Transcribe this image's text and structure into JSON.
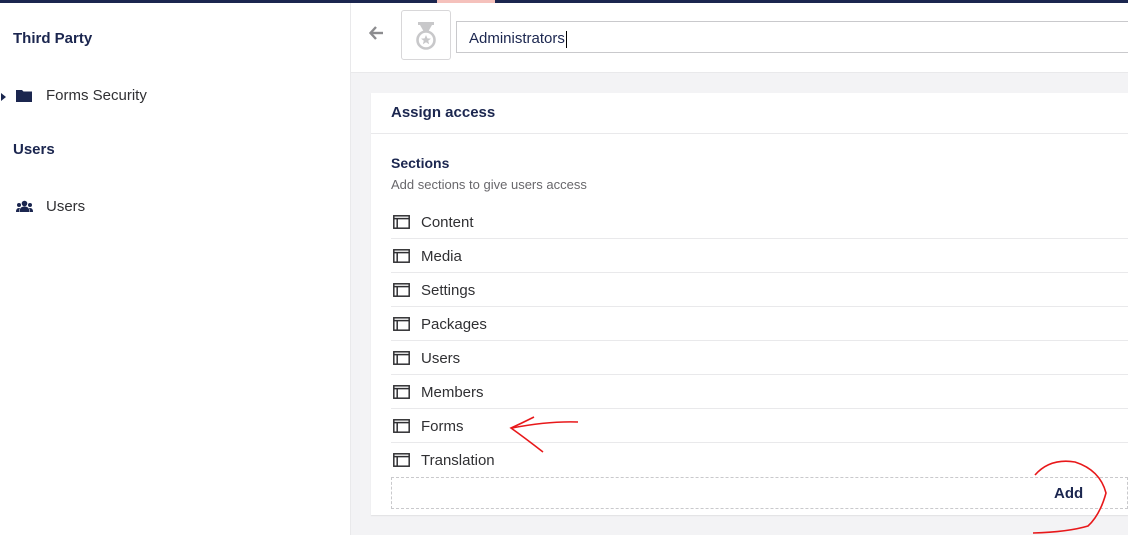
{
  "sidebar": {
    "sections": [
      {
        "heading": "Third Party",
        "items": [
          {
            "label": "Forms Security",
            "icon": "folder-icon"
          }
        ]
      },
      {
        "heading": "Users",
        "items": [
          {
            "label": "Users",
            "icon": "users-icon"
          }
        ]
      }
    ]
  },
  "header": {
    "group_icon": "medal-icon",
    "name_value": "Administrators"
  },
  "panel": {
    "title": "Assign access",
    "sections_title": "Sections",
    "sections_description": "Add sections to give users access",
    "sections": [
      "Content",
      "Media",
      "Settings",
      "Packages",
      "Users",
      "Members",
      "Forms",
      "Translation"
    ],
    "add_label": "Add"
  },
  "colors": {
    "navy": "#1b264f",
    "annotation_red": "#e8181a",
    "top_accent": "#f5c1bc"
  }
}
